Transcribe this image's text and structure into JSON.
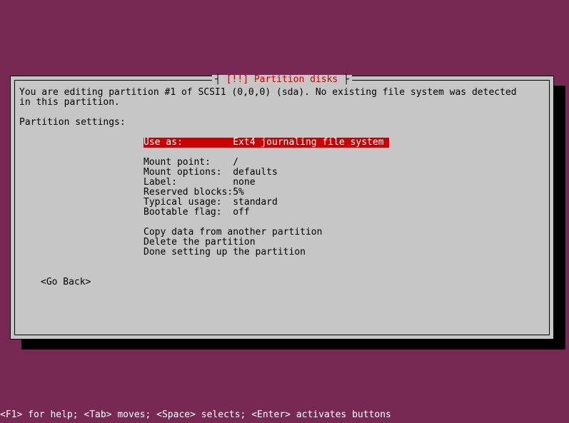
{
  "dialog": {
    "title_prefix": "[!!] ",
    "title_text": "Partition disks",
    "intro_line1": "You are editing partition #1 of SCSI1 (0,0,0) (sda). No existing file system was detected",
    "intro_line2": "in this partition.",
    "settings_header": "Partition settings:",
    "rows": [
      {
        "label": "Use as:",
        "value": "Ext4 journaling file system",
        "selected": true
      },
      {
        "label": "Mount point:",
        "value": "/"
      },
      {
        "label": "Mount options:",
        "value": "defaults"
      },
      {
        "label": "Label:",
        "value": "none"
      },
      {
        "label": "Reserved blocks:",
        "value": "5%"
      },
      {
        "label": "Typical usage:",
        "value": "standard"
      },
      {
        "label": "Bootable flag:",
        "value": "off"
      }
    ],
    "actions": [
      "Copy data from another partition",
      "Delete the partition",
      "Done setting up the partition"
    ],
    "go_back": "<Go Back>"
  },
  "footer": "<F1> for help; <Tab> moves; <Space> selects; <Enter> activates buttons"
}
